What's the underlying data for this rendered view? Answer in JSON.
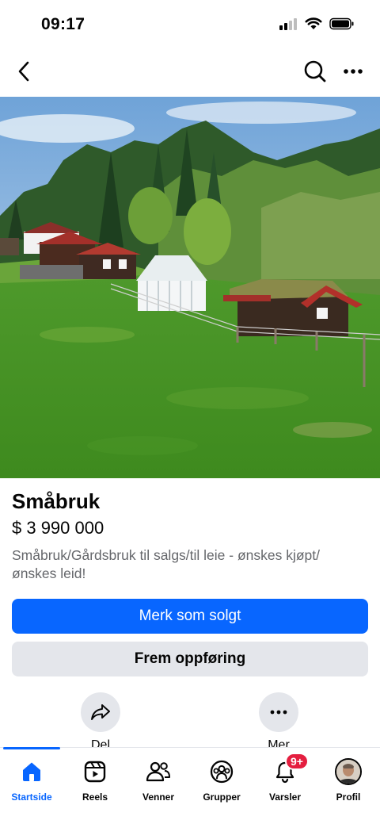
{
  "status_bar": {
    "time": "09:17"
  },
  "photo": {
    "page_count": 6,
    "active_index": 3
  },
  "listing": {
    "title": "Småbruk",
    "price": "$ 3 990 000",
    "description": "Småbruk/Gårdsbruk til salgs/til leie - ønskes kjøpt/ ønskes leid!"
  },
  "buttons": {
    "mark_sold": "Merk som solgt",
    "promote": "Frem oppføring"
  },
  "actions": {
    "share": "Del",
    "more": "Mer"
  },
  "tabbar": {
    "items": [
      {
        "label": "Startside",
        "icon": "home-icon"
      },
      {
        "label": "Reels",
        "icon": "reels-icon"
      },
      {
        "label": "Venner",
        "icon": "friends-icon"
      },
      {
        "label": "Grupper",
        "icon": "groups-icon"
      },
      {
        "label": "Varsler",
        "icon": "bell-icon",
        "badge": "9+"
      },
      {
        "label": "Profil",
        "icon": "avatar"
      }
    ]
  },
  "colors": {
    "accent": "#0866ff",
    "badge": "#e41e3f",
    "secondary_bg": "#e4e6eb"
  }
}
